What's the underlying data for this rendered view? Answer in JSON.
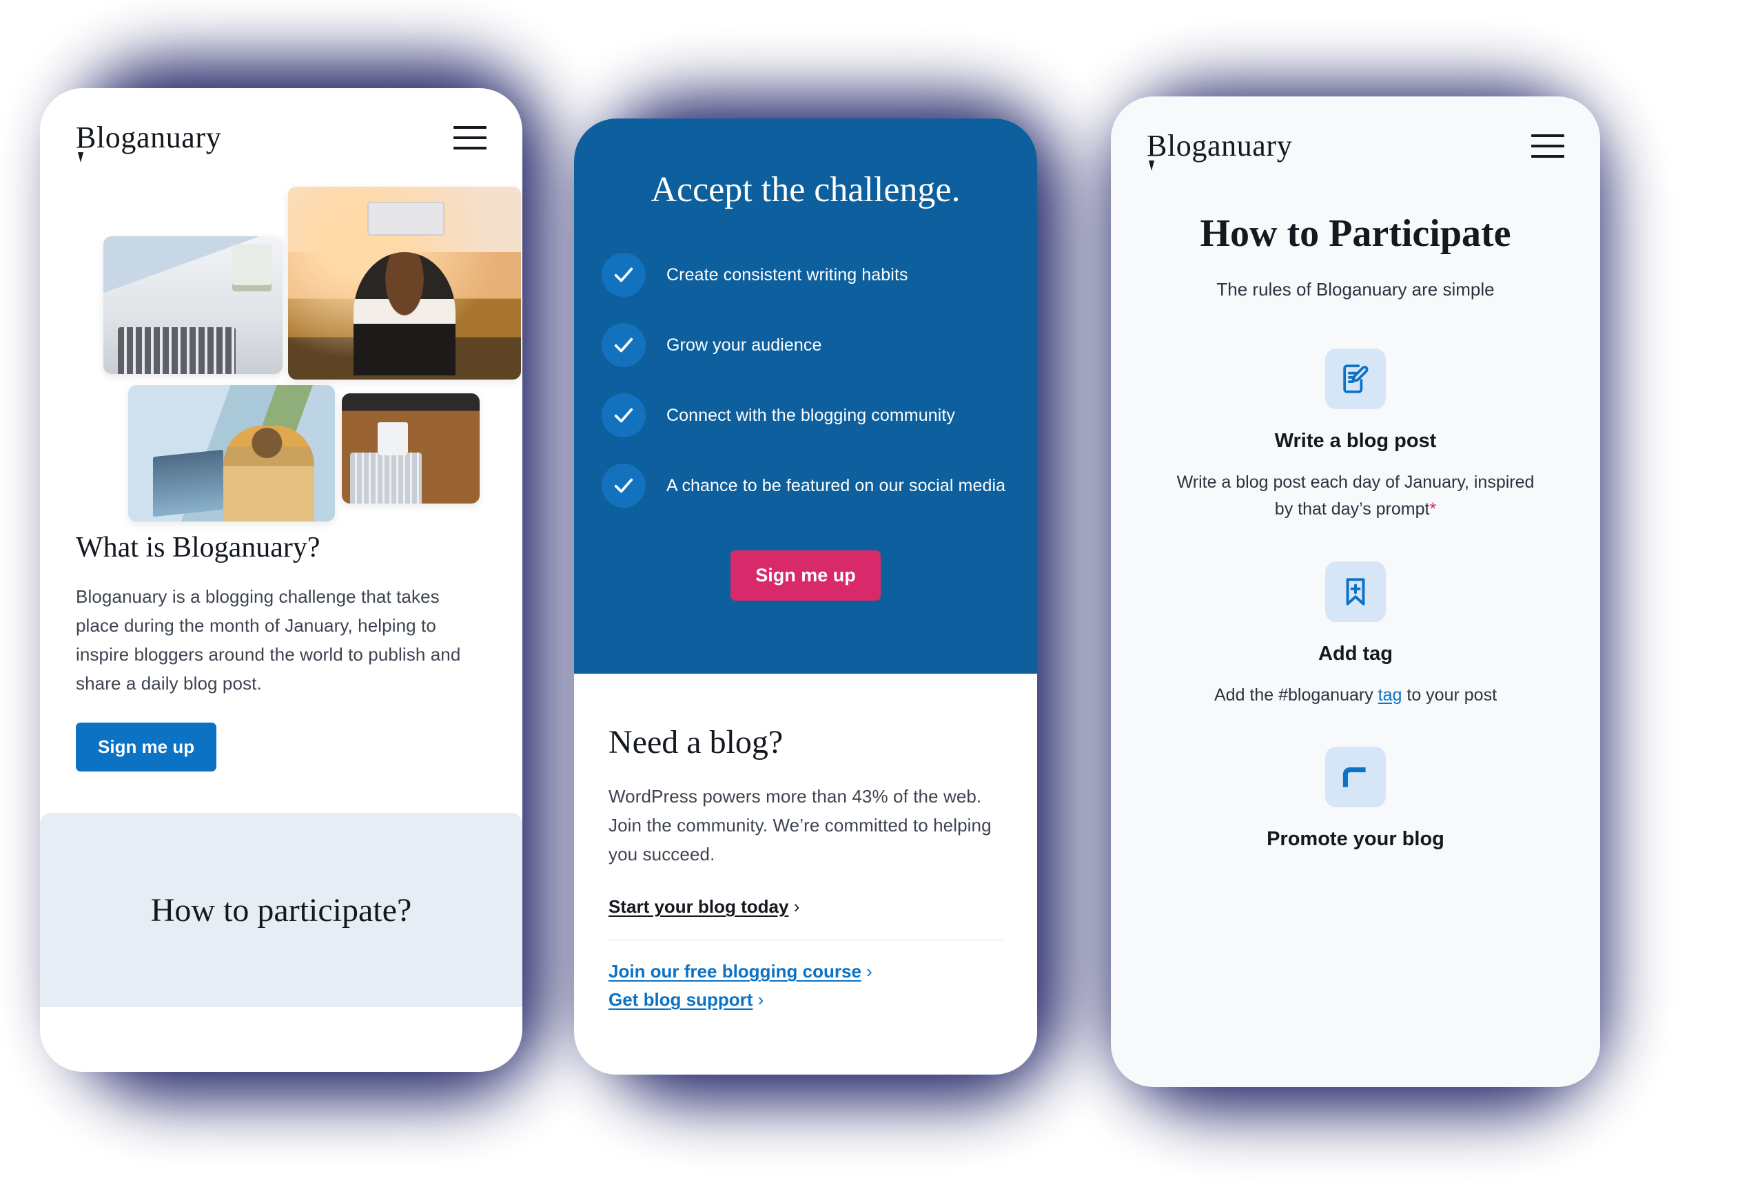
{
  "brand": {
    "name": "Bloganuary",
    "accent_blue": "#0b72c4",
    "hero_blue": "#0d5f9e",
    "accent_pink": "#d82a6a",
    "panel_grey_blue": "#e7edf4",
    "icon_tile_blue": "#d6e6f7",
    "backdrop_navy": "#1b1f63"
  },
  "icons": {
    "menu": "hamburger-menu-icon",
    "check": "checkmark-icon",
    "write": "document-pencil-icon",
    "tag": "bookmark-plus-icon",
    "promote": "megaphone-icon",
    "chevron": "›"
  },
  "phone1": {
    "logo": "Bloganuary",
    "menu_label": "Menu",
    "photos": [
      {
        "name": "hands-writing-at-laptop"
      },
      {
        "name": "woman-taking-photo-at-sunset"
      },
      {
        "name": "man-on-balcony-with-laptop"
      },
      {
        "name": "coffee-notebook-and-laptop"
      }
    ],
    "heading": "What is Bloganuary?",
    "body": "Bloganuary is a blogging challenge that takes place during the month of January, helping to inspire bloggers around the world to publish and share a daily blog post.",
    "cta_label": "Sign me up",
    "panel_heading": "How to participate?"
  },
  "phone2": {
    "hero_title": "Accept the challenge.",
    "checklist": [
      "Create consistent writing habits",
      "Grow your audience",
      "Connect with the blogging community",
      "A chance to be featured on our social media"
    ],
    "cta_label": "Sign me up",
    "need_heading": "Need a blog?",
    "need_body": "WordPress powers more than 43% of the web. Join the community. We’re committed to helping you succeed.",
    "links": [
      {
        "label": "Start your blog today",
        "style": "dark"
      },
      {
        "label": "Join our free blogging course",
        "style": "blue"
      },
      {
        "label": "Get blog support",
        "style": "blue"
      }
    ]
  },
  "phone3": {
    "logo": "Bloganuary",
    "menu_label": "Menu",
    "heading": "How to Participate",
    "subtitle": "The rules of Bloganuary are simple",
    "steps": [
      {
        "icon": "document-pencil-icon",
        "title": "Write a blog post",
        "desc_before": "Write a blog post each day of January, inspired by that day’s prompt",
        "desc_star": "*",
        "desc_after": ""
      },
      {
        "icon": "bookmark-plus-icon",
        "title": "Add tag",
        "desc_before": "Add the #bloganuary ",
        "desc_link": "tag",
        "desc_after": " to your post"
      },
      {
        "icon": "megaphone-icon",
        "title": "Promote your blog",
        "desc_before": "",
        "desc_after": ""
      }
    ]
  }
}
